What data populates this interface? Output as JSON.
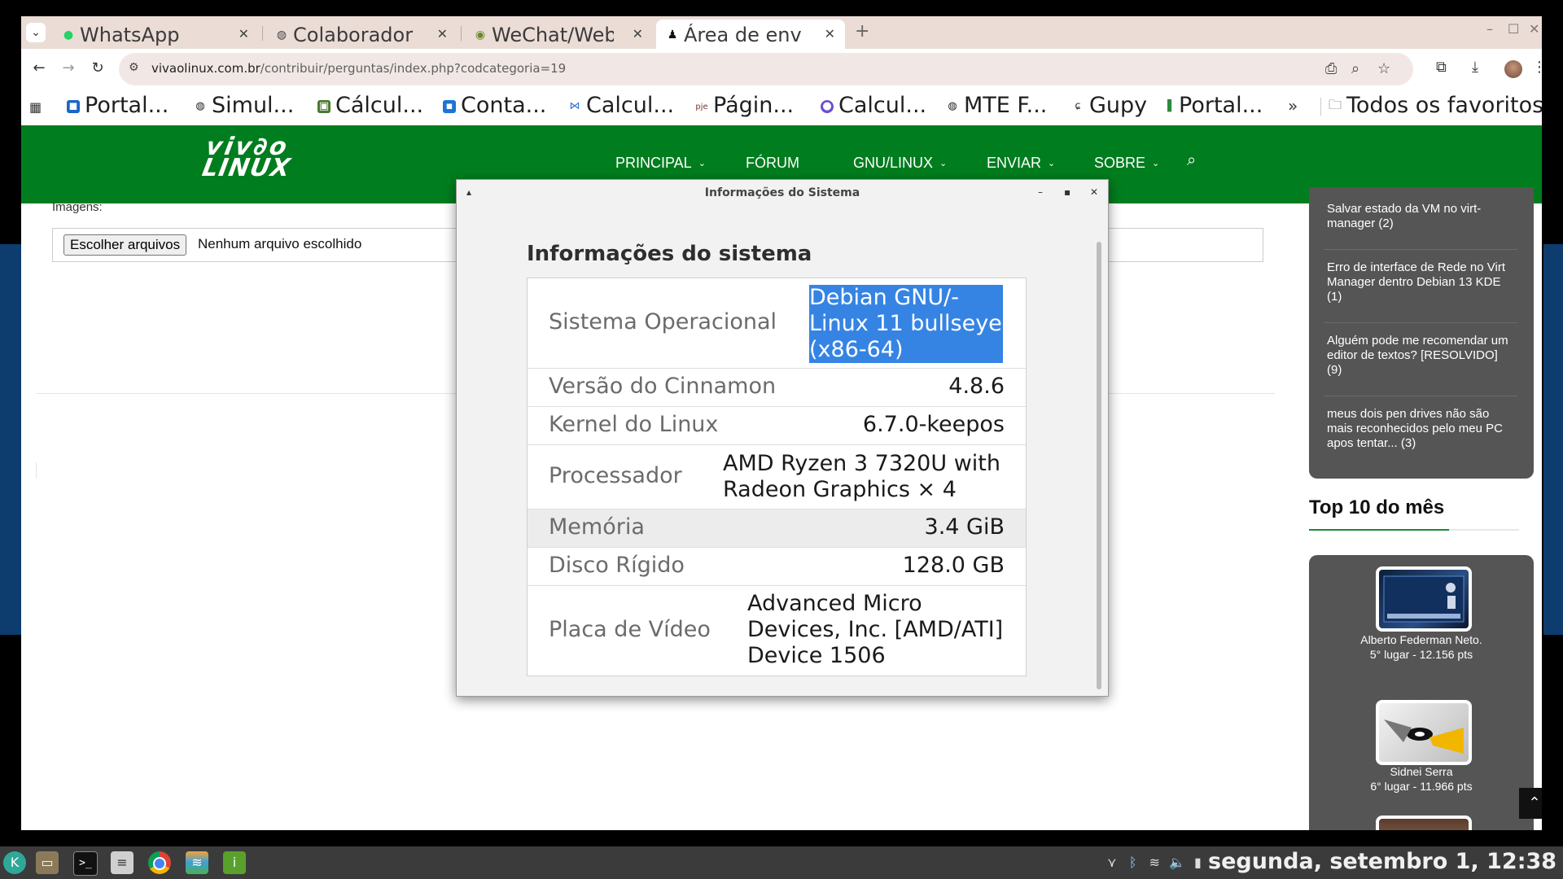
{
  "tabs": [
    {
      "title": "WhatsApp",
      "icon": "whatsapp-icon"
    },
    {
      "title": "Colaborador",
      "icon": "globe-icon"
    },
    {
      "title": "WeChat/Web",
      "icon": "wechat-icon"
    },
    {
      "title": "Área de env",
      "icon": "tux-icon",
      "active": true
    }
  ],
  "toolbar": {
    "url_domain": "vivaolinux.com.br",
    "url_path": "/contribuir/perguntas/index.php?codcategoria=19"
  },
  "bookmarks": {
    "items": [
      {
        "label": "Portal...",
        "color": "#1a66c9"
      },
      {
        "label": "Simul...",
        "color": "#222222"
      },
      {
        "label": "Cálcul...",
        "color": "#4a7a2f"
      },
      {
        "label": "Conta...",
        "color": "#1f73d6"
      },
      {
        "label": "Calcul...",
        "color": "#2f6fd0"
      },
      {
        "label": "Págin...",
        "color": "#7a3333"
      },
      {
        "label": "Calcul...",
        "color": "#6a4fd3"
      },
      {
        "label": "MTE F...",
        "color": "#222222"
      },
      {
        "label": "Gupy",
        "color": "#333333"
      },
      {
        "label": "Portal...",
        "color": "#2b8a3e"
      }
    ],
    "all_favorites": "Todos os favoritos"
  },
  "site": {
    "logo_line1": "viv∂o",
    "logo_line2": "LINUX",
    "nav": [
      "PRINCIPAL",
      "FÓRUM",
      "GNU/LINUX",
      "ENVIAR",
      "SOBRE"
    ],
    "brand_color": "#007d1e"
  },
  "form": {
    "images_label": "Imagens:",
    "file_button": "Escolher arquivos",
    "file_none": "Nenhum arquivo escolhido"
  },
  "sidebar": {
    "recent": [
      "Salvar estado da VM no virt-manager (2)",
      "Erro de interface de Rede no Virt Manager dentro Debian 13 KDE (1)",
      "Alguém pode me recomendar um editor de textos? [RESOLVIDO] (9)",
      "meus dois pen drives não são mais reconhecidos pelo meu PC apos tentar... (3)"
    ],
    "top10_title": "Top 10 do mês",
    "ranking": [
      {
        "name": "Alberto Federman Neto.",
        "pts": "5° lugar - 12.156 pts"
      },
      {
        "name": "Sidnei Serra",
        "pts": "6° lugar - 11.966 pts"
      }
    ]
  },
  "dialog": {
    "title": "Informações do Sistema",
    "heading": "Informações do sistema",
    "rows": [
      {
        "label": "Sistema Operacional",
        "value": "Debian GNU/-Linux 11 bullseye (x86-64)"
      },
      {
        "label": "Versão do Cinnamon",
        "value": "4.8.6"
      },
      {
        "label": "Kernel do Linux",
        "value": "6.7.0-keepos"
      },
      {
        "label": "Processador",
        "value_lines": [
          "AMD Ryzen 3 7320U with",
          "Radeon Graphics × 4"
        ]
      },
      {
        "label": "Memória",
        "value": "3.4 GiB"
      },
      {
        "label": "Disco Rígido",
        "value": "128.0 GB"
      },
      {
        "label": "Placa de Vídeo",
        "value_lines": [
          "Advanced Micro",
          "Devices, Inc. [AMD/ATI]",
          "Device 1506"
        ]
      }
    ],
    "selection_color": "#3584e4"
  },
  "taskbar": {
    "clock": "segunda, setembro  1, 12:38"
  }
}
